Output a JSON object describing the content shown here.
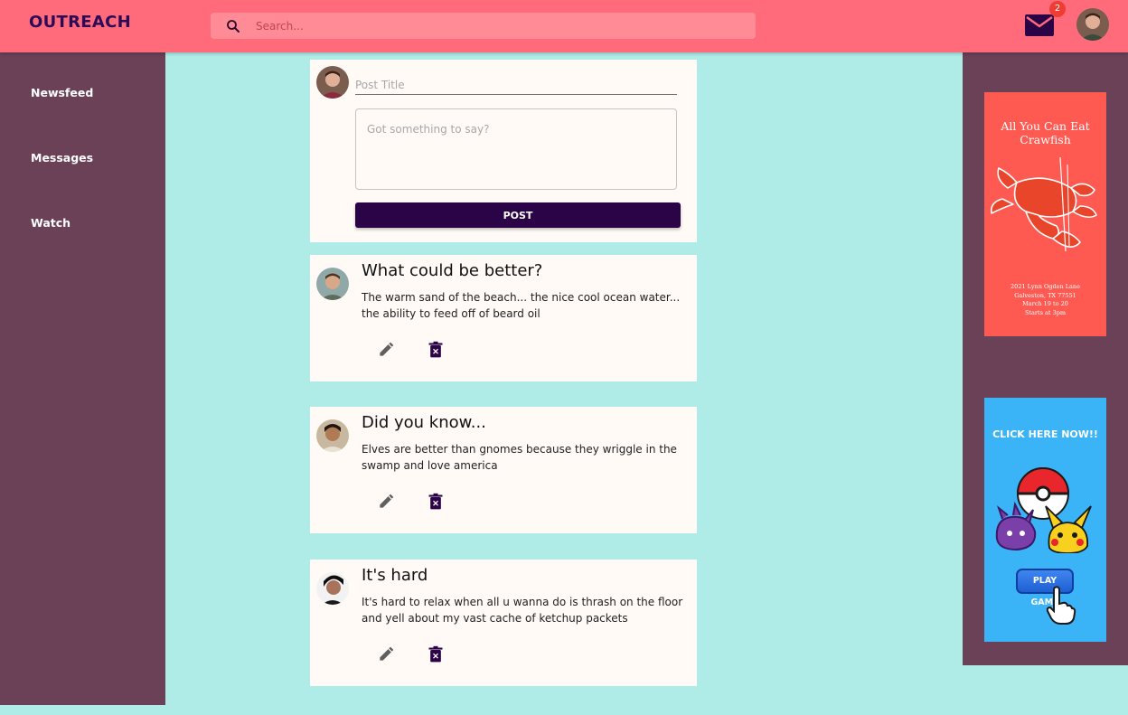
{
  "header": {
    "logo": "OUTREACH",
    "search_placeholder": "Search...",
    "notification_count": "2"
  },
  "sidebar": {
    "items": [
      {
        "label": "Newsfeed"
      },
      {
        "label": "Messages"
      },
      {
        "label": "Watch"
      }
    ]
  },
  "composer": {
    "title_placeholder": "Post Title",
    "body_placeholder": "Got something to say?",
    "post_label": "POST"
  },
  "posts": [
    {
      "title": "What could be better?",
      "body": "The warm sand of the beach... the nice cool ocean water... the ability to feed off of beard oil"
    },
    {
      "title": "Did you know...",
      "body": "Elves are better than gnomes because they wriggle in the swamp and love america"
    },
    {
      "title": "It's hard",
      "body": "It's hard to relax when all u wanna do is thrash on the floor and yell about my vast cache of ketchup packets"
    }
  ],
  "ads": {
    "crawfish": {
      "title": "All You Can Eat Crawfish",
      "address_line1": "2021 Lynn Ogden Lane",
      "address_line2": "Galveston, TX 77551",
      "address_line3": "March 19 to 20",
      "address_line4": "Starts at 3pm"
    },
    "game": {
      "cta": "CLICK HERE NOW!!",
      "button": "PLAY GAME"
    }
  },
  "colors": {
    "header": "#ff6b7a",
    "sidebar": "#6b4157",
    "background": "#b0ece7",
    "card": "#fffaf6",
    "accent": "#2a0446",
    "badge": "#ef3d34"
  },
  "icons": [
    "search-icon",
    "mail-icon",
    "edit-icon",
    "delete-icon"
  ]
}
